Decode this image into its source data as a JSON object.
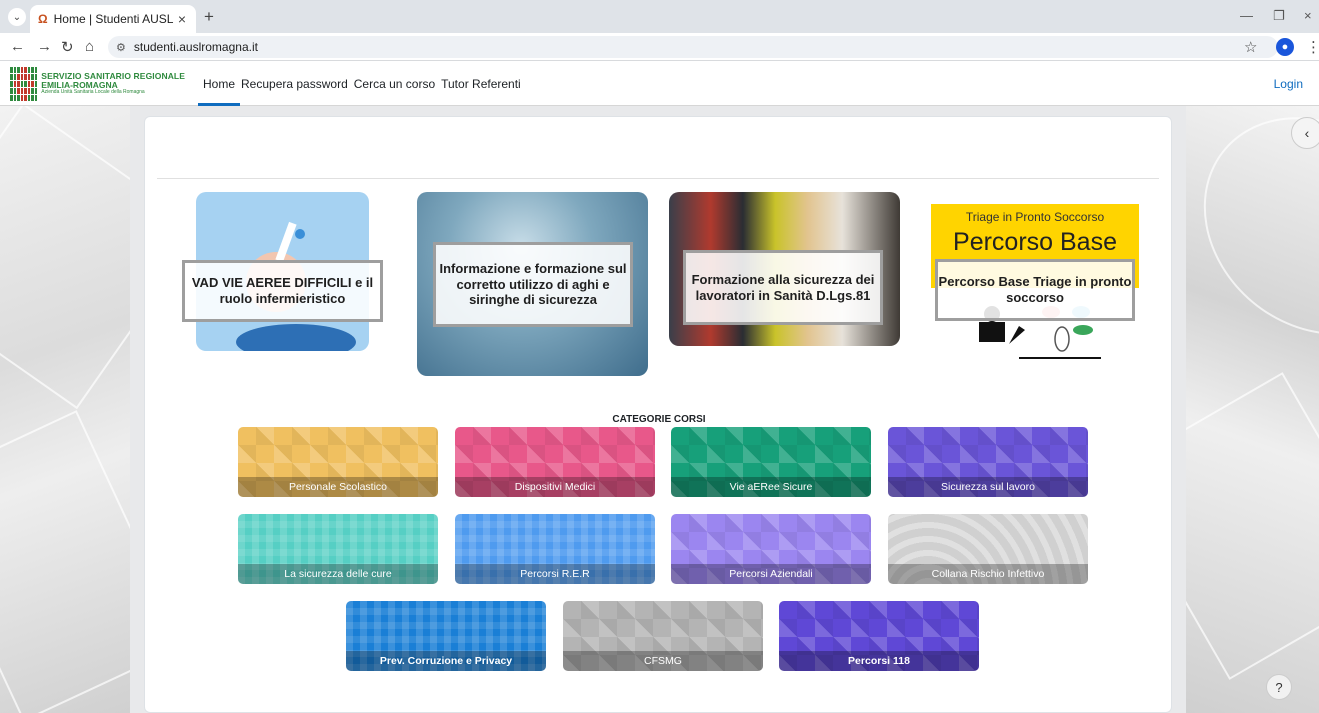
{
  "browser": {
    "tab_title": "Home | Studenti AUSL",
    "tab_favicon": "Ω",
    "url": "studenti.auslromagna.it"
  },
  "site": {
    "logo": {
      "line1": "SERVIZIO SANITARIO REGIONALE",
      "line2": "EMILIA-ROMAGNA",
      "line3": "Azienda Unità Sanitaria Locale della Romagna"
    },
    "nav": [
      {
        "label": "Home",
        "active": true
      },
      {
        "label": "Recupera password"
      },
      {
        "label": "Cerca un corso"
      },
      {
        "label": "Tutor Referenti"
      }
    ],
    "login": "Login"
  },
  "courses": [
    {
      "title": "VAD VIE AEREE DIFFICILI e il ruolo infermieristico"
    },
    {
      "title": "Informazione e formazione sul corretto utilizzo di aghi e siringhe di sicurezza"
    },
    {
      "title": "Formazione alla sicurezza dei lavoratori in Sanità D.Lgs.81"
    },
    {
      "title": "Percorso Base Triage in pronto soccorso",
      "image_top": "Triage in Pronto Soccorso",
      "image_headline": "Percorso Base"
    }
  ],
  "categories_title": "CATEGORIE CORSI",
  "categories": [
    {
      "label": "Personale Scolastico",
      "color": "#f0c060"
    },
    {
      "label": "Dispositivi Medici",
      "color": "#e8588a"
    },
    {
      "label": "Vie aERee Sicure",
      "color": "#17a07a"
    },
    {
      "label": "Sicurezza sul lavoro",
      "color": "#6a55d8"
    },
    {
      "label": "La sicurezza delle cure",
      "color": "#56cfc4"
    },
    {
      "label": "Percorsi R.E.R",
      "color": "#4f9bef"
    },
    {
      "label": "Percorsi Aziendali",
      "color": "#9b86f0"
    },
    {
      "label": "Collana Rischio Infettivo",
      "color": "#d0d0d0"
    },
    {
      "label": "Prev. Corruzione e Privacy",
      "color": "#1a7fd6"
    },
    {
      "label": "CFSMG",
      "color": "#b4b4b4"
    },
    {
      "label": "Percorsi 118",
      "color": "#5f48d6"
    }
  ],
  "help_label": "?"
}
